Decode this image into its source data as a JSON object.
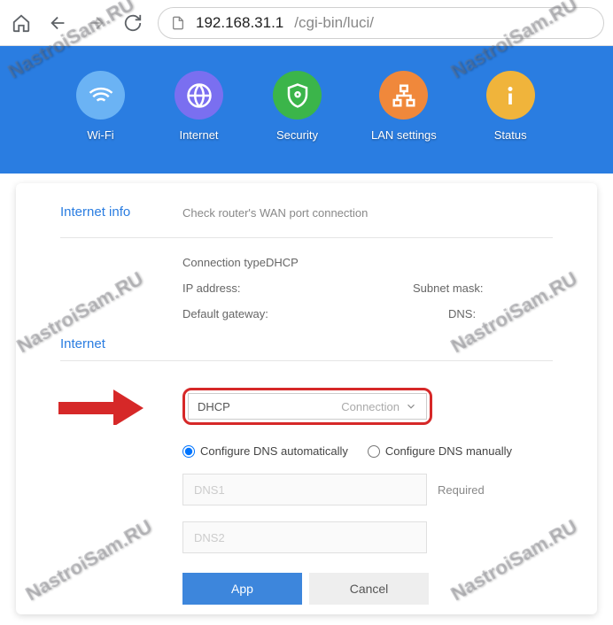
{
  "browser": {
    "url_host": "192.168.31.1",
    "url_path": "/cgi-bin/luci/"
  },
  "tabs": {
    "wifi": "Wi-Fi",
    "internet": "Internet",
    "security": "Security",
    "lan": "LAN settings",
    "status": "Status"
  },
  "info": {
    "section_title": "Internet info",
    "hint": "Check router's WAN port connection",
    "conn_type_label": "Connection type",
    "conn_type_value": "DHCP",
    "ip_label": "IP address:",
    "subnet_label": "Subnet mask:",
    "gateway_label": "Default gateway:",
    "dns_label": "DNS:"
  },
  "internet": {
    "section_title": "Internet",
    "select_value": "DHCP",
    "select_right": "Connection",
    "radio_auto": "Configure DNS automatically",
    "radio_manual": "Configure DNS manually",
    "dns1_placeholder": "DNS1",
    "dns2_placeholder": "DNS2",
    "required": "Required",
    "btn_app": "App",
    "btn_cancel": "Cancel"
  },
  "watermark": "NastroiSam.RU"
}
